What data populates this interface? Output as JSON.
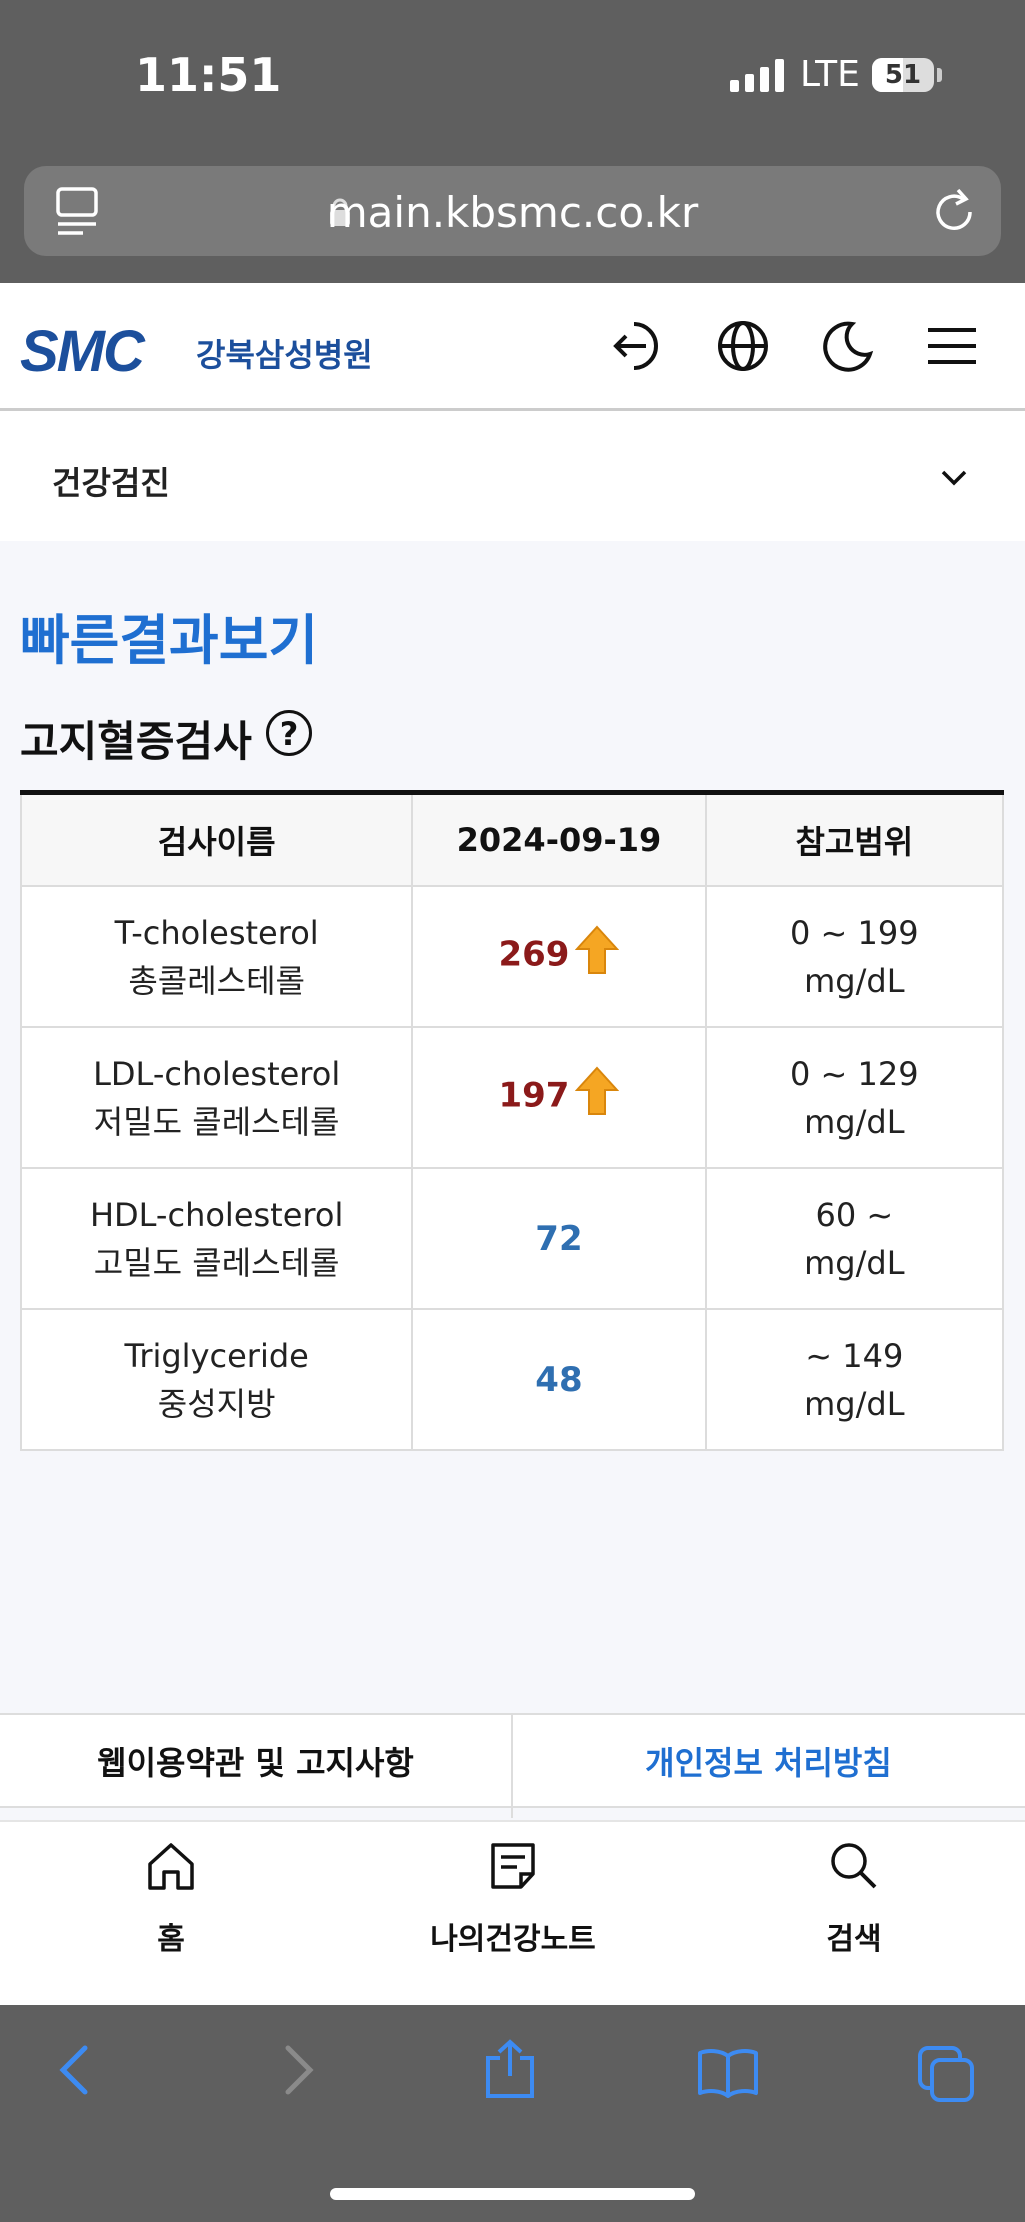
{
  "status": {
    "time": "11:51",
    "network": "LTE",
    "battery": "51"
  },
  "browser": {
    "url": "main.kbsmc.co.kr"
  },
  "site": {
    "logo": "SMC",
    "hospital": "강북삼성병원"
  },
  "breadcrumb": {
    "label": "건강검진"
  },
  "page": {
    "title": "빠른결과보기",
    "section": "고지혈증검사",
    "help": "?"
  },
  "table": {
    "headers": [
      "검사이름",
      "2024-09-19",
      "참고범위"
    ],
    "rows": [
      {
        "name_en": "T-cholesterol",
        "name_ko": "총콜레스테롤",
        "value": "269",
        "flag": "high",
        "range": "0 ~ 199",
        "unit": "mg/dL"
      },
      {
        "name_en": "LDL-cholesterol",
        "name_ko": "저밀도 콜레스테롤",
        "value": "197",
        "flag": "high",
        "range": "0 ~ 129",
        "unit": "mg/dL"
      },
      {
        "name_en": "HDL-cholesterol",
        "name_ko": "고밀도 콜레스테롤",
        "value": "72",
        "flag": "normal",
        "range": "60 ~",
        "unit": "mg/dL"
      },
      {
        "name_en": "Triglyceride",
        "name_ko": "중성지방",
        "value": "48",
        "flag": "normal",
        "range": "~ 149",
        "unit": "mg/dL"
      }
    ]
  },
  "footer": {
    "terms": "웹이용약관 및 고지사항",
    "privacy": "개인정보 처리방침"
  },
  "nav": {
    "home": "홈",
    "note": "나의건강노트",
    "search": "검색"
  },
  "colors": {
    "brand": "#1c4f9c",
    "accent": "#1f6fd1",
    "high": "#8b1a1a",
    "normal": "#2f6fb1",
    "arrow": "#f5a623"
  }
}
